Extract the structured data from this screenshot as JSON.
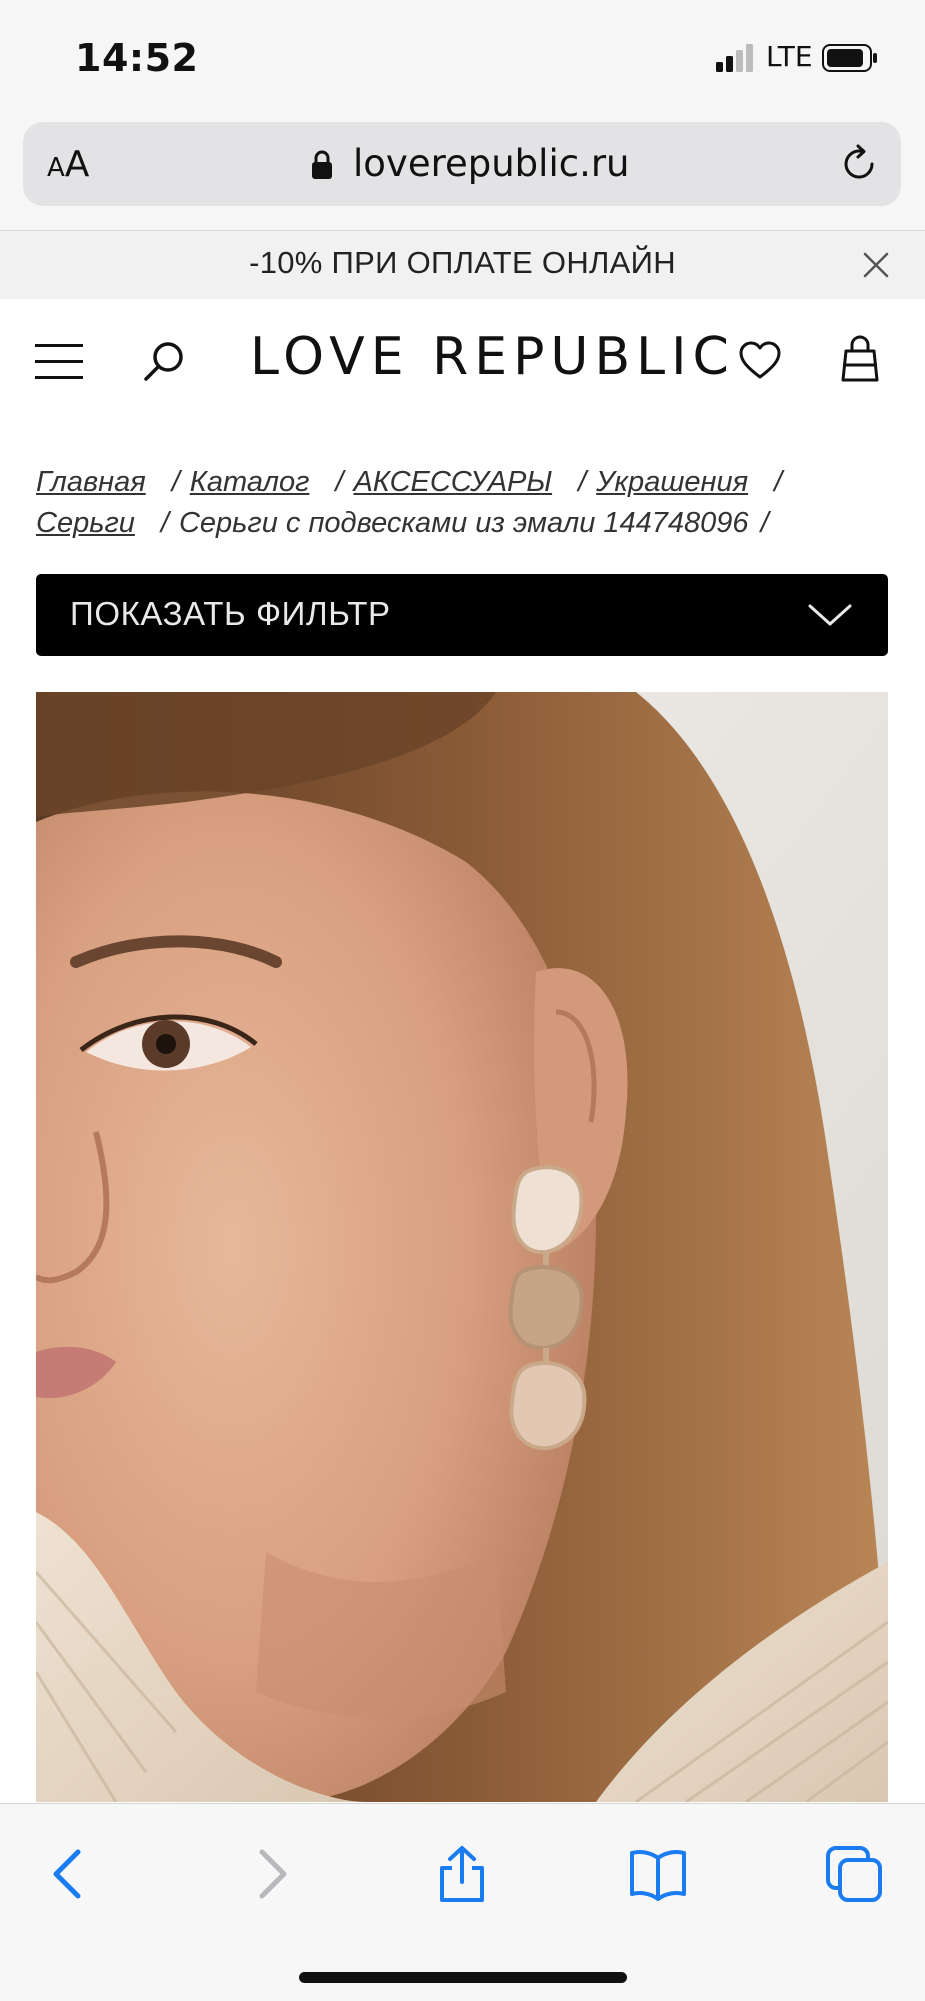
{
  "status_bar": {
    "time": "14:52",
    "network": "LTE",
    "icons": [
      "signal-icon",
      "battery-icon"
    ]
  },
  "browser": {
    "text_size_label_small": "A",
    "text_size_label_large": "A",
    "domain": "loverepublic.ru",
    "icons": [
      "lock-icon",
      "reload-icon"
    ]
  },
  "promo": {
    "text": "-10% ПРИ ОПЛАТЕ ОНЛАЙН",
    "icons": [
      "close-icon"
    ]
  },
  "header": {
    "logo": "LOVE REPUBLIC",
    "icons": [
      "menu-icon",
      "search-icon",
      "heart-icon",
      "bag-icon"
    ]
  },
  "breadcrumb": {
    "items": [
      "Главная",
      "Каталог",
      "АКСЕССУАРЫ",
      "Украшения",
      "Серьги"
    ],
    "current": "Серьги с подвесками из эмали 144748096",
    "separator": "/"
  },
  "filter": {
    "label": "ПОКАЗАТЬ ФИЛЬТР",
    "icons": [
      "chevron-down-icon"
    ]
  },
  "product": {
    "image": "product-photo"
  },
  "toolbar": {
    "icons": [
      "back-icon",
      "forward-icon",
      "share-icon",
      "bookmarks-icon",
      "tabs-icon"
    ],
    "accent": "#1a7cf0",
    "disabled": "#b8b8bd"
  }
}
